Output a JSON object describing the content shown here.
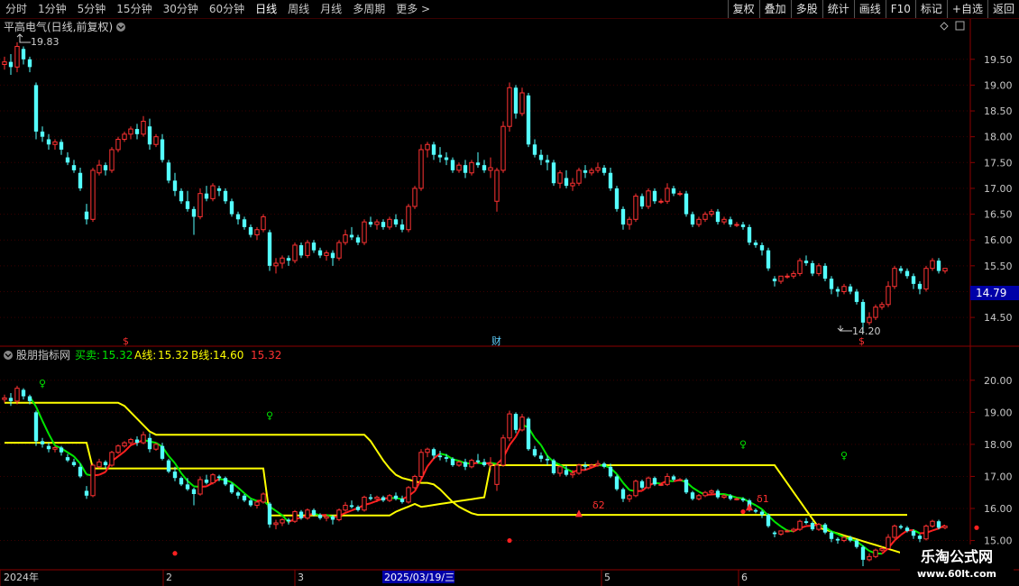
{
  "toolbar": {
    "timeframes": [
      "分时",
      "1分钟",
      "5分钟",
      "15分钟",
      "30分钟",
      "60分钟",
      "日线",
      "周线",
      "月线",
      "多周期",
      "更多 >"
    ],
    "active": "日线",
    "buttons": [
      "复权",
      "叠加",
      "多股",
      "统计",
      "画线",
      "F10",
      "标记",
      "+自选",
      "返回"
    ]
  },
  "main_panel": {
    "title": "平高电气(日线,前复权)",
    "price_axis": [
      "19.50",
      "19.00",
      "18.50",
      "18.00",
      "17.50",
      "17.00",
      "16.50",
      "16.00",
      "15.50",
      "15.00",
      "14.50"
    ],
    "current_price": "14.79",
    "high_label": "19.83",
    "low_label": "14.20",
    "markers": [
      "$",
      "财",
      "$"
    ]
  },
  "indicator_panel": {
    "name": "股朋指标网",
    "mm_label": "买卖:",
    "mm_value": "15.32",
    "a_label": "A线:",
    "a_value": "15.32",
    "b_label": "B线:",
    "b_value": "14.60",
    "extra_value": "15.32",
    "axis": [
      "20.00",
      "19.00",
      "18.00",
      "17.00",
      "16.00",
      "15.00"
    ],
    "signals": [
      "δ2",
      "δ1",
      "δ1"
    ]
  },
  "date_axis": [
    "2024年",
    "2",
    "3",
    "2025/03/19/三",
    "5",
    "6"
  ],
  "watermark": {
    "line1": "乐淘公式网",
    "line2": "www.60lt.com"
  },
  "colors": {
    "up": "#ff3232",
    "down": "#54ffff",
    "yellow": "#ffff00",
    "green": "#00e600",
    "accent_bg": "#0000a8"
  },
  "chart_data": {
    "type": "candlestick",
    "title": "平高电气(日线,前复权)",
    "ylim_main": [
      14.1,
      19.95
    ],
    "ylim_indicator": [
      14.2,
      20.5
    ],
    "ohlc": [
      [
        19.4,
        19.55,
        19.3,
        19.45
      ],
      [
        19.45,
        19.6,
        19.2,
        19.35
      ],
      [
        19.35,
        19.83,
        19.25,
        19.75
      ],
      [
        19.7,
        19.75,
        19.4,
        19.5
      ],
      [
        19.5,
        19.55,
        19.25,
        19.35
      ],
      [
        19.0,
        19.05,
        17.95,
        18.1
      ],
      [
        18.1,
        18.2,
        17.9,
        18.0
      ],
      [
        17.95,
        18.05,
        17.75,
        17.85
      ],
      [
        17.85,
        17.95,
        17.75,
        17.9
      ],
      [
        17.9,
        17.95,
        17.65,
        17.75
      ],
      [
        17.6,
        17.7,
        17.45,
        17.5
      ],
      [
        17.45,
        17.55,
        17.3,
        17.35
      ],
      [
        17.3,
        17.4,
        16.95,
        17.0
      ],
      [
        16.55,
        16.7,
        16.3,
        16.4
      ],
      [
        16.4,
        17.4,
        16.35,
        17.35
      ],
      [
        17.3,
        17.55,
        17.25,
        17.45
      ],
      [
        17.45,
        17.5,
        17.25,
        17.35
      ],
      [
        17.35,
        17.8,
        17.3,
        17.75
      ],
      [
        17.75,
        18.0,
        17.7,
        17.95
      ],
      [
        17.95,
        18.1,
        17.9,
        18.05
      ],
      [
        18.05,
        18.2,
        17.95,
        18.15
      ],
      [
        18.15,
        18.25,
        17.95,
        18.05
      ],
      [
        18.05,
        18.4,
        18.0,
        18.3
      ],
      [
        18.2,
        18.35,
        17.75,
        17.85
      ],
      [
        17.85,
        18.05,
        17.8,
        18.0
      ],
      [
        17.95,
        18.05,
        17.5,
        17.55
      ],
      [
        17.5,
        17.55,
        17.1,
        17.15
      ],
      [
        17.15,
        17.3,
        16.85,
        16.95
      ],
      [
        16.95,
        17.0,
        16.7,
        16.75
      ],
      [
        16.75,
        16.95,
        16.55,
        16.6
      ],
      [
        16.6,
        16.65,
        16.1,
        16.45
      ],
      [
        16.45,
        17.0,
        16.4,
        16.9
      ],
      [
        16.9,
        17.05,
        16.75,
        16.8
      ],
      [
        16.8,
        17.1,
        16.75,
        17.05
      ],
      [
        17.0,
        17.05,
        16.85,
        16.95
      ],
      [
        16.95,
        17.0,
        16.7,
        16.75
      ],
      [
        16.75,
        16.8,
        16.45,
        16.5
      ],
      [
        16.5,
        16.55,
        16.3,
        16.4
      ],
      [
        16.4,
        16.45,
        16.2,
        16.25
      ],
      [
        16.25,
        16.3,
        16.05,
        16.1
      ],
      [
        16.1,
        16.25,
        16.0,
        16.2
      ],
      [
        16.2,
        16.5,
        16.15,
        16.45
      ],
      [
        16.15,
        16.2,
        15.4,
        15.5
      ],
      [
        15.5,
        15.65,
        15.35,
        15.55
      ],
      [
        15.55,
        15.7,
        15.45,
        15.65
      ],
      [
        15.65,
        15.7,
        15.5,
        15.6
      ],
      [
        15.6,
        15.95,
        15.55,
        15.9
      ],
      [
        15.9,
        15.95,
        15.65,
        15.7
      ],
      [
        15.7,
        16.0,
        15.65,
        15.95
      ],
      [
        15.95,
        16.0,
        15.75,
        15.8
      ],
      [
        15.8,
        15.85,
        15.65,
        15.7
      ],
      [
        15.7,
        15.8,
        15.6,
        15.75
      ],
      [
        15.75,
        15.8,
        15.5,
        15.65
      ],
      [
        15.65,
        16.0,
        15.6,
        15.95
      ],
      [
        15.95,
        16.2,
        15.9,
        16.1
      ],
      [
        16.1,
        16.25,
        16.0,
        16.05
      ],
      [
        16.05,
        16.1,
        15.9,
        15.95
      ],
      [
        15.95,
        16.4,
        15.9,
        16.35
      ],
      [
        16.35,
        16.45,
        16.25,
        16.3
      ],
      [
        16.3,
        16.4,
        16.2,
        16.35
      ],
      [
        16.35,
        16.4,
        16.2,
        16.25
      ],
      [
        16.25,
        16.45,
        16.2,
        16.4
      ],
      [
        16.4,
        16.5,
        16.25,
        16.3
      ],
      [
        16.3,
        16.4,
        16.15,
        16.2
      ],
      [
        16.2,
        16.7,
        16.15,
        16.65
      ],
      [
        16.65,
        17.05,
        16.6,
        17.0
      ],
      [
        17.0,
        17.85,
        16.95,
        17.75
      ],
      [
        17.75,
        17.9,
        17.6,
        17.85
      ],
      [
        17.85,
        17.9,
        17.55,
        17.65
      ],
      [
        17.65,
        17.8,
        17.5,
        17.6
      ],
      [
        17.6,
        17.7,
        17.45,
        17.55
      ],
      [
        17.55,
        17.6,
        17.3,
        17.35
      ],
      [
        17.35,
        17.5,
        17.3,
        17.45
      ],
      [
        17.45,
        17.55,
        17.2,
        17.3
      ],
      [
        17.3,
        17.55,
        17.25,
        17.5
      ],
      [
        17.5,
        17.7,
        17.4,
        17.45
      ],
      [
        17.45,
        17.55,
        17.3,
        17.35
      ],
      [
        17.35,
        17.6,
        17.2,
        17.4
      ],
      [
        16.75,
        17.4,
        16.55,
        17.35
      ],
      [
        17.35,
        18.3,
        17.3,
        18.2
      ],
      [
        18.2,
        19.05,
        18.1,
        18.95
      ],
      [
        18.95,
        19.0,
        18.35,
        18.45
      ],
      [
        18.45,
        18.95,
        18.4,
        18.85
      ],
      [
        18.8,
        18.85,
        17.8,
        17.85
      ],
      [
        17.85,
        17.95,
        17.6,
        17.65
      ],
      [
        17.65,
        17.75,
        17.45,
        17.55
      ],
      [
        17.55,
        17.65,
        17.35,
        17.5
      ],
      [
        17.5,
        17.55,
        17.05,
        17.1
      ],
      [
        17.1,
        17.35,
        17.0,
        17.3
      ],
      [
        17.2,
        17.35,
        17.0,
        17.05
      ],
      [
        17.05,
        17.2,
        16.95,
        17.1
      ],
      [
        17.1,
        17.4,
        17.05,
        17.35
      ],
      [
        17.35,
        17.45,
        17.2,
        17.3
      ],
      [
        17.3,
        17.4,
        17.25,
        17.35
      ],
      [
        17.35,
        17.5,
        17.3,
        17.4
      ],
      [
        17.4,
        17.45,
        17.25,
        17.3
      ],
      [
        17.3,
        17.4,
        16.95,
        17.0
      ],
      [
        17.0,
        17.05,
        16.55,
        16.6
      ],
      [
        16.6,
        16.65,
        16.2,
        16.3
      ],
      [
        16.3,
        16.45,
        16.2,
        16.4
      ],
      [
        16.4,
        16.9,
        16.35,
        16.85
      ],
      [
        16.85,
        16.9,
        16.6,
        16.65
      ],
      [
        16.65,
        17.0,
        16.6,
        16.95
      ],
      [
        16.95,
        17.0,
        16.7,
        16.75
      ],
      [
        16.75,
        16.8,
        16.7,
        16.75
      ],
      [
        16.75,
        17.1,
        16.7,
        17.0
      ],
      [
        17.0,
        17.05,
        16.85,
        16.9
      ],
      [
        16.9,
        16.95,
        16.85,
        16.9
      ],
      [
        16.9,
        16.95,
        16.45,
        16.5
      ],
      [
        16.5,
        16.55,
        16.25,
        16.3
      ],
      [
        16.3,
        16.45,
        16.25,
        16.4
      ],
      [
        16.4,
        16.55,
        16.35,
        16.5
      ],
      [
        16.5,
        16.6,
        16.45,
        16.55
      ],
      [
        16.55,
        16.6,
        16.3,
        16.35
      ],
      [
        16.35,
        16.45,
        16.3,
        16.4
      ],
      [
        16.4,
        16.45,
        16.25,
        16.3
      ],
      [
        16.3,
        16.35,
        16.25,
        16.3
      ],
      [
        16.3,
        16.35,
        16.2,
        16.25
      ],
      [
        16.25,
        16.3,
        15.9,
        15.95
      ],
      [
        15.95,
        16.0,
        15.85,
        15.9
      ],
      [
        15.9,
        15.95,
        15.7,
        15.8
      ],
      [
        15.8,
        15.85,
        15.4,
        15.45
      ],
      [
        15.25,
        15.3,
        15.1,
        15.2
      ],
      [
        15.2,
        15.3,
        15.15,
        15.3
      ],
      [
        15.3,
        15.35,
        15.25,
        15.3
      ],
      [
        15.3,
        15.4,
        15.25,
        15.35
      ],
      [
        15.35,
        15.65,
        15.3,
        15.6
      ],
      [
        15.6,
        15.7,
        15.5,
        15.55
      ],
      [
        15.55,
        15.6,
        15.3,
        15.35
      ],
      [
        15.35,
        15.55,
        15.3,
        15.5
      ],
      [
        15.5,
        15.55,
        15.2,
        15.25
      ],
      [
        15.25,
        15.3,
        14.95,
        15.05
      ],
      [
        15.05,
        15.1,
        14.9,
        15.0
      ],
      [
        15.0,
        15.15,
        14.95,
        15.1
      ],
      [
        15.1,
        15.15,
        14.95,
        15.0
      ],
      [
        15.0,
        15.05,
        14.75,
        14.8
      ],
      [
        14.8,
        14.85,
        14.2,
        14.4
      ],
      [
        14.4,
        14.6,
        14.35,
        14.5
      ],
      [
        14.5,
        14.75,
        14.45,
        14.7
      ],
      [
        14.7,
        14.8,
        14.65,
        14.75
      ],
      [
        14.75,
        15.2,
        14.7,
        15.1
      ],
      [
        15.1,
        15.5,
        15.05,
        15.45
      ],
      [
        15.45,
        15.5,
        15.35,
        15.4
      ],
      [
        15.4,
        15.45,
        15.25,
        15.3
      ],
      [
        15.3,
        15.35,
        15.05,
        15.15
      ],
      [
        15.15,
        15.2,
        14.95,
        15.05
      ],
      [
        15.05,
        15.5,
        15.0,
        15.45
      ],
      [
        15.45,
        15.65,
        15.4,
        15.6
      ],
      [
        15.6,
        15.65,
        15.35,
        15.4
      ],
      [
        15.4,
        15.45,
        15.35,
        15.45
      ]
    ],
    "series": [
      {
        "name": "A线",
        "color": "#ffff00",
        "values": [
          19.3,
          19.3,
          19.3,
          19.3,
          19.3,
          19.3,
          19.3,
          19.3,
          19.3,
          19.3,
          19.3,
          19.3,
          19.3,
          19.3,
          19.3,
          19.3,
          19.3,
          19.3,
          19.3,
          19.2,
          19.0,
          18.8,
          18.6,
          18.4,
          18.3,
          18.3,
          18.3,
          18.3,
          18.3,
          18.3,
          18.3,
          18.3,
          18.3,
          18.3,
          18.3,
          18.3,
          18.3,
          18.3,
          18.3,
          18.3,
          18.3,
          18.3,
          18.3,
          18.3,
          18.3,
          18.3,
          18.3,
          18.3,
          18.3,
          18.3,
          18.3,
          18.3,
          18.3,
          18.3,
          18.3,
          18.3,
          18.3,
          18.3,
          18.1,
          17.8,
          17.5,
          17.25,
          17.05,
          16.95,
          16.9,
          16.85,
          16.8,
          16.8,
          16.75,
          16.6,
          16.4,
          16.2,
          16.05,
          15.95,
          15.85,
          15.8,
          15.8,
          15.8,
          15.8,
          15.8,
          15.8,
          15.8,
          15.8,
          15.8,
          15.8,
          15.8,
          15.8,
          15.8,
          15.8,
          15.8,
          15.8,
          15.8,
          15.8,
          15.8,
          15.8,
          15.8,
          15.8,
          15.8,
          15.8,
          15.8,
          15.8,
          15.8,
          15.8,
          15.8,
          15.8,
          15.8,
          15.8,
          15.8,
          15.8,
          15.8,
          15.8,
          15.8,
          15.8,
          15.8,
          15.8,
          15.8,
          15.8,
          15.8,
          15.8,
          15.8,
          15.8,
          15.8,
          15.8,
          15.8,
          15.8,
          15.8,
          15.8,
          15.8,
          15.8,
          15.8,
          15.8,
          15.8,
          15.8,
          15.8,
          15.8,
          15.8,
          15.8,
          15.8,
          15.8,
          15.8,
          15.8,
          15.8,
          15.8,
          15.8
        ]
      }
    ]
  }
}
